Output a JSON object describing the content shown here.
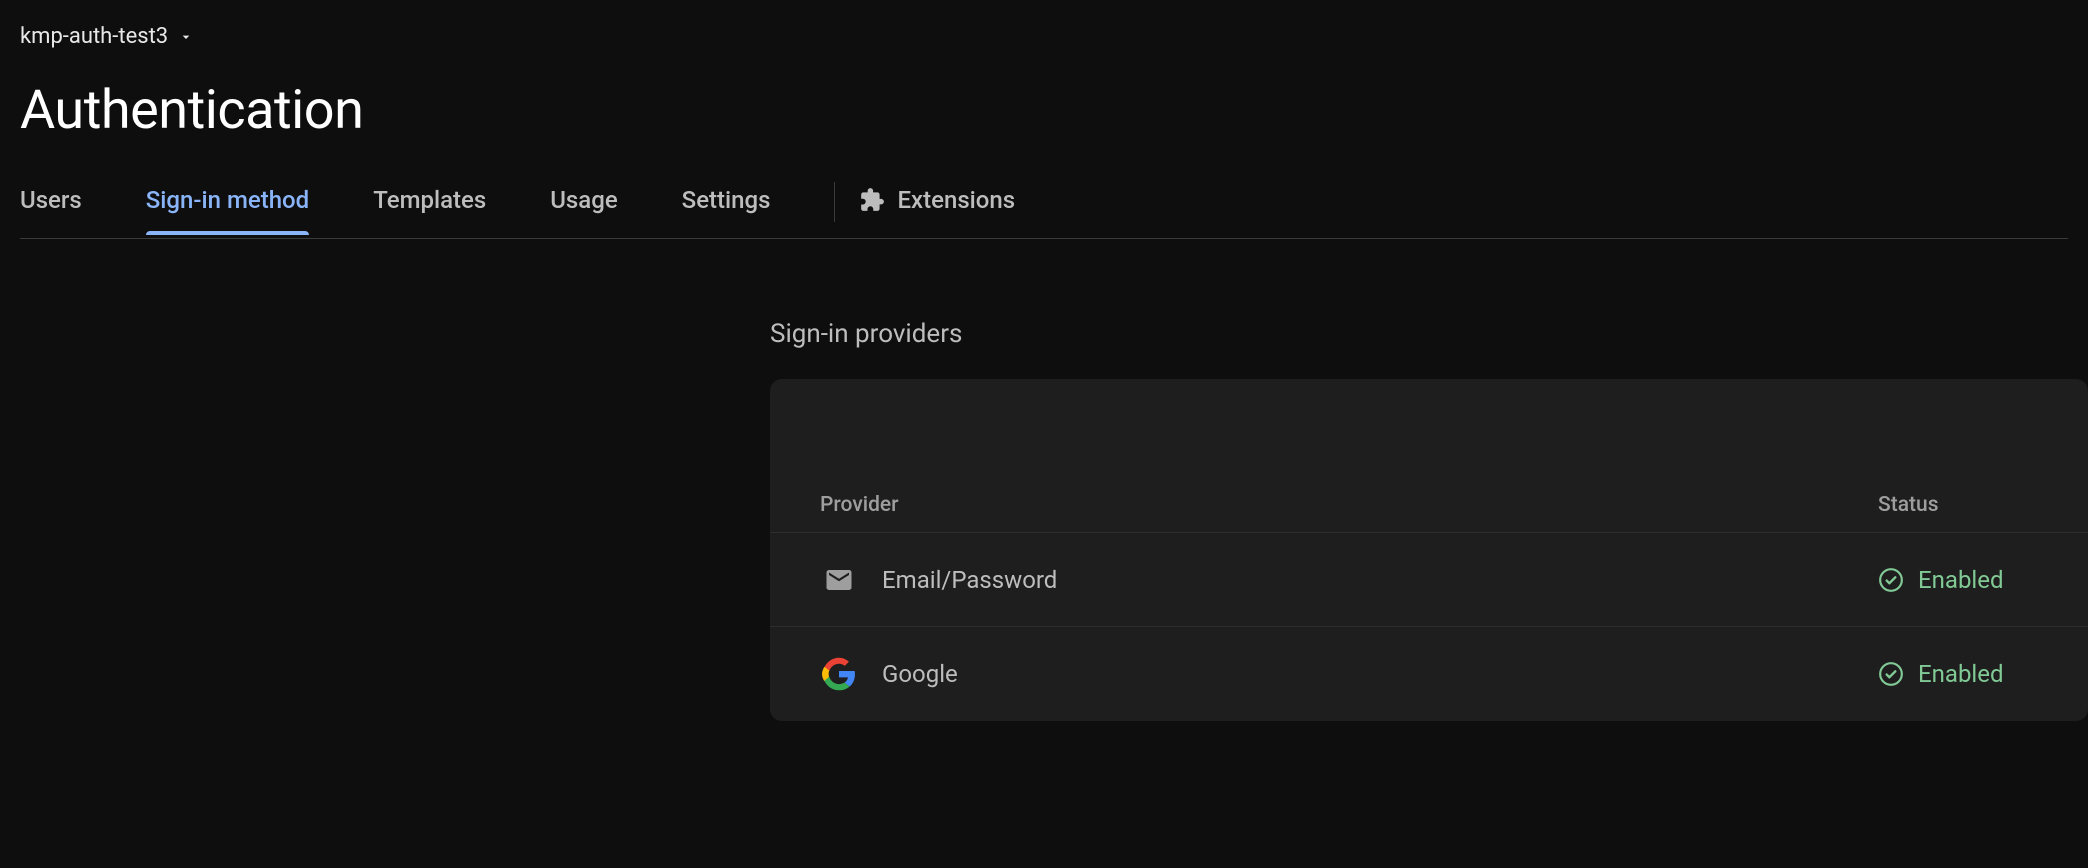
{
  "header": {
    "project_name": "kmp-auth-test3",
    "page_title": "Authentication"
  },
  "tabs": {
    "items": [
      {
        "label": "Users"
      },
      {
        "label": "Sign-in method"
      },
      {
        "label": "Templates"
      },
      {
        "label": "Usage"
      },
      {
        "label": "Settings"
      },
      {
        "label": "Extensions"
      }
    ],
    "active_index": 1
  },
  "section": {
    "title": "Sign-in providers",
    "columns": {
      "provider": "Provider",
      "status": "Status"
    },
    "providers": [
      {
        "name": "Email/Password",
        "icon": "email-icon",
        "status": "Enabled"
      },
      {
        "name": "Google",
        "icon": "google-icon",
        "status": "Enabled"
      }
    ]
  },
  "colors": {
    "accent": "#8ab4f8",
    "success": "#81c995",
    "card_bg": "#1e1e1e",
    "page_bg": "#0e0e0e"
  }
}
